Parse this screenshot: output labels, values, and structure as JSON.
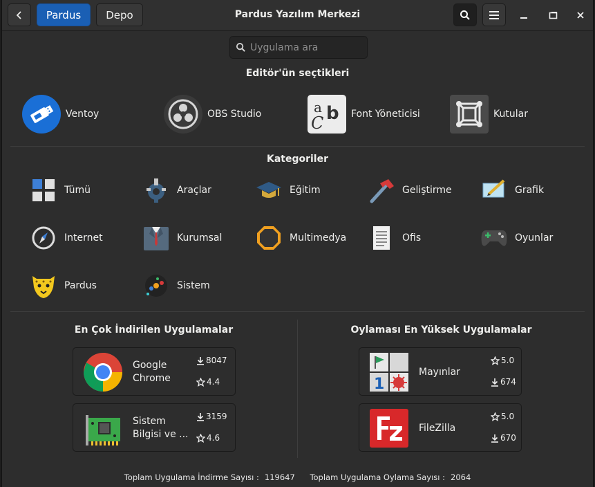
{
  "window": {
    "title": "Pardus Yazılım Merkezi",
    "tabs": [
      "Pardus",
      "Depo"
    ],
    "search_placeholder": "Uygulama ara"
  },
  "editors": {
    "title": "Editör'ün seçtikleri",
    "items": [
      {
        "label": "Ventoy",
        "icon": "usb-drive-icon"
      },
      {
        "label": "OBS Studio",
        "icon": "obs-icon"
      },
      {
        "label": "Font Yöneticisi",
        "icon": "font-icon"
      },
      {
        "label": "Kutular",
        "icon": "boxes-icon"
      }
    ]
  },
  "categories": {
    "title": "Kategoriler",
    "items": [
      {
        "label": "Tümü"
      },
      {
        "label": "Araçlar"
      },
      {
        "label": "Eğitim"
      },
      {
        "label": "Geliştirme"
      },
      {
        "label": "Grafik"
      },
      {
        "label": "Internet"
      },
      {
        "label": "Kurumsal"
      },
      {
        "label": "Multimedya"
      },
      {
        "label": "Ofis"
      },
      {
        "label": "Oyunlar"
      },
      {
        "label": "Pardus"
      },
      {
        "label": "Sistem"
      }
    ]
  },
  "most_downloaded": {
    "title": "En Çok İndirilen Uygulamalar",
    "apps": [
      {
        "name": "Google Chrome",
        "downloads": "8047",
        "rating": "4.4"
      },
      {
        "name": "Sistem Bilgisi ve ...",
        "downloads": "3159",
        "rating": "4.6"
      }
    ]
  },
  "top_rated": {
    "title": "Oylaması En Yüksek Uygulamalar",
    "apps": [
      {
        "name": "Mayınlar",
        "rating": "5.0",
        "downloads": "674"
      },
      {
        "name": "FileZilla",
        "rating": "5.0",
        "downloads": "670"
      }
    ]
  },
  "footer": {
    "downloads_label": "Toplam Uygulama İndirme Sayısı :",
    "downloads_value": "119647",
    "ratings_label": "Toplam Uygulama Oylama Sayısı :",
    "ratings_value": "2064"
  },
  "colors": {
    "accent": "#1a5fb4",
    "background": "#2d2d2d"
  }
}
